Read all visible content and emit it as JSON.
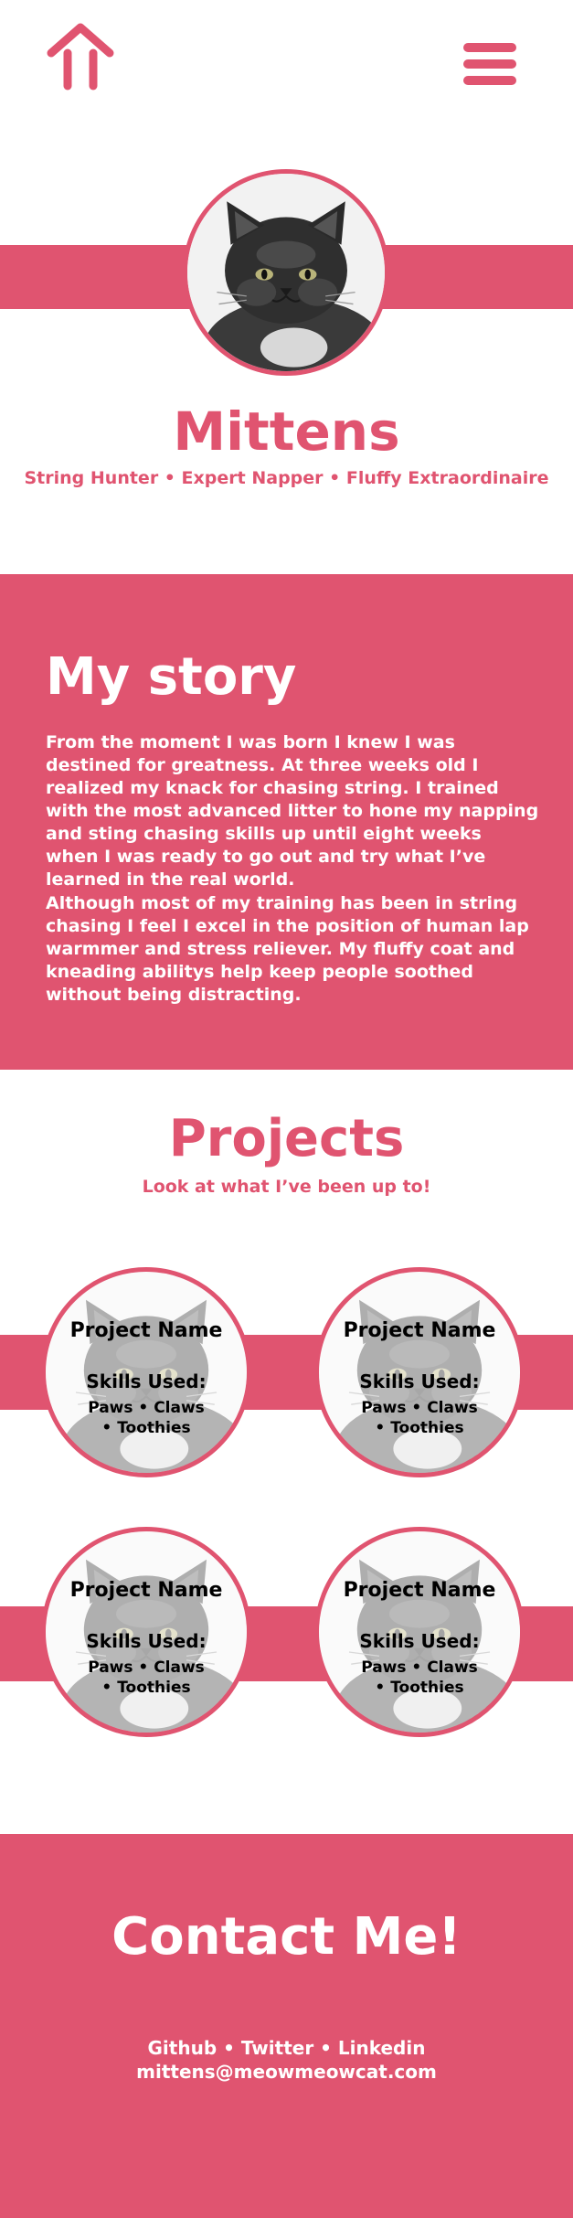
{
  "header": {
    "home_icon": "home-arrow-icon",
    "menu_icon": "hamburger-menu-icon"
  },
  "colors": {
    "accent": "#e05470",
    "background": "#ffffff",
    "text_on_accent": "#ffffff"
  },
  "hero": {
    "avatar": "cat-avatar",
    "name": "Mittens",
    "tagline": "String Hunter • Expert Napper • Fluffy Extraordinaire"
  },
  "story": {
    "heading": "My story",
    "paragraphs": [
      "From the moment I was born I knew I was destined for greatness. At three weeks old I realized my knack for chasing string. I trained with the most advanced litter to hone my napping and sting chasing skills up until eight weeks when I was ready to go out and try what I’ve learned in the real world.",
      "Although most of my training has been in string chasing I feel I excel in the position of human lap warmmer and stress reliever. My fluffy coat and kneading abilitys help keep people soothed without being distracting."
    ]
  },
  "projects": {
    "heading": "Projects",
    "subheading": "Look at what I’ve been up to!",
    "items": [
      {
        "title": "Project Name",
        "skills_label": "Skills Used:",
        "skills": "Paws • Claws • Toothies"
      },
      {
        "title": "Project Name",
        "skills_label": "Skills Used:",
        "skills": "Paws • Claws • Toothies"
      },
      {
        "title": "Project Name",
        "skills_label": "Skills Used:",
        "skills": "Paws • Claws • Toothies"
      },
      {
        "title": "Project Name",
        "skills_label": "Skills Used:",
        "skills": "Paws • Claws • Toothies"
      }
    ]
  },
  "contact": {
    "heading": "Contact Me!",
    "links": "Github • Twitter • Linkedin",
    "email": "mittens@meowmeowcat.com"
  }
}
